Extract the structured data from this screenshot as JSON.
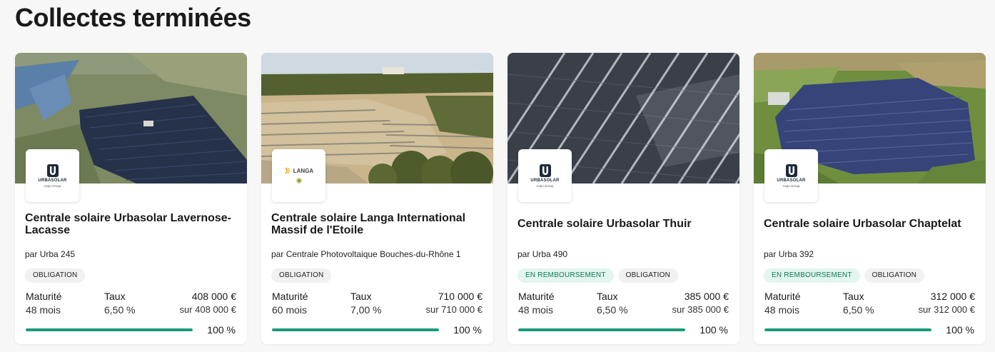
{
  "section": {
    "title": "Collectes terminées"
  },
  "labels": {
    "by_prefix": "par",
    "maturity": "Maturité",
    "rate": "Taux"
  },
  "colors": {
    "accent": "#1a9a78",
    "tag_remb_bg": "#e2f5ee",
    "tag_remb_text": "#0e7a5a",
    "tag_oblig_bg": "#f1f1f1"
  },
  "projects": [
    {
      "title": "Centrale solaire Urbasolar Lavernose-Lacasse",
      "by": "Urba 245",
      "logo": {
        "kind": "urbasolar",
        "wordmark": "URBASOLAR",
        "sub": "Axpo Group"
      },
      "image": "aerial-solar-farm-lake",
      "tags": [
        "OBLIGATION"
      ],
      "maturity": "48 mois",
      "rate": "6,50 %",
      "amount": "408 000 €",
      "total": "sur 408 000 €",
      "progress": 1.0,
      "progress_label": "100 %"
    },
    {
      "title": "Centrale solaire Langa International Massif de l'Etoile",
      "by": "Centrale Photovoltaique Bouches-du-Rhône 1",
      "logo": {
        "kind": "langa",
        "wordmark": "LANGA"
      },
      "image": "hillside-solar-terraces",
      "tags": [
        "OBLIGATION"
      ],
      "maturity": "60 mois",
      "rate": "7,00 %",
      "amount": "710 000 €",
      "total": "sur 710 000 €",
      "progress": 1.0,
      "progress_label": "100 %"
    },
    {
      "title": "Centrale solaire Urbasolar Thuir",
      "by": "Urba 490",
      "logo": {
        "kind": "urbasolar",
        "wordmark": "URBASOLAR",
        "sub": "Axpo Group"
      },
      "image": "close-up-solar-panel-rows",
      "tags": [
        "EN REMBOURSEMENT",
        "OBLIGATION"
      ],
      "maturity": "48 mois",
      "rate": "6,50 %",
      "amount": "385 000 €",
      "total": "sur 385 000 €",
      "progress": 1.0,
      "progress_label": "100 %"
    },
    {
      "title": "Centrale solaire Urbasolar Chaptelat",
      "by": "Urba 392",
      "logo": {
        "kind": "urbasolar",
        "wordmark": "URBASOLAR",
        "sub": "Axpo Group"
      },
      "image": "aerial-solar-farm-fields",
      "tags": [
        "EN REMBOURSEMENT",
        "OBLIGATION"
      ],
      "maturity": "48 mois",
      "rate": "6,50 %",
      "amount": "312 000 €",
      "total": "sur 312 000 €",
      "progress": 1.0,
      "progress_label": "100 %"
    }
  ]
}
